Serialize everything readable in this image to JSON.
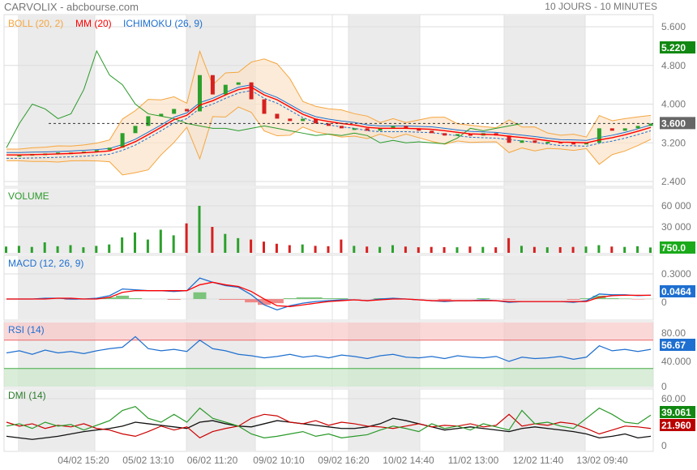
{
  "header": {
    "title": "CARVOLIX - abcbourse.com",
    "period": "10 JOURS - 10 MINUTES"
  },
  "legend": {
    "boll": "BOLL (20, 2)",
    "mm": "MM (20)",
    "ichimoku": "ICHIMOKU (26, 9)",
    "volume": "VOLUME",
    "macd": "MACD (12, 26, 9)",
    "rsi": "RSI (14)",
    "dmi": "DMI (14)"
  },
  "colors": {
    "boll": "#f5a640",
    "mm": "#ff0000",
    "ichimoku": "#1e6fd0",
    "up": "#2ca02c",
    "down": "#d62020",
    "rsi": "#1e6fd0",
    "dmi_plus": "#2a9a2a",
    "dmi_minus": "#cc0000",
    "adx": "#111111"
  },
  "chart_data": {
    "type": "line",
    "x_labels": [
      "04/02 15:20",
      "05/02 13:10",
      "06/02 11:20",
      "09/02 10:10",
      "09/02 16:20",
      "10/02 14:40",
      "11/02 13:00",
      "12/02 11:40",
      "13/02 09:40"
    ],
    "price": {
      "ticks": [
        "5.600",
        "4.800",
        "4.000",
        "3.200",
        "2.400"
      ],
      "ylim": [
        2.4,
        5.6
      ],
      "close": [
        2.95,
        2.95,
        2.97,
        2.98,
        3.0,
        3.0,
        3.02,
        3.05,
        3.1,
        3.4,
        3.55,
        3.75,
        3.8,
        3.9,
        3.85,
        4.6,
        4.2,
        4.4,
        4.45,
        4.1,
        3.8,
        3.7,
        3.65,
        3.7,
        3.6,
        3.55,
        3.5,
        3.5,
        3.45,
        3.5,
        3.55,
        3.5,
        3.45,
        3.4,
        3.35,
        3.38,
        3.35,
        3.4,
        3.35,
        3.2,
        3.25,
        3.2,
        3.22,
        3.2,
        3.18,
        3.2,
        3.5,
        3.45,
        3.5,
        3.55,
        3.6
      ],
      "chikou": [
        3.1,
        3.6,
        4.0,
        3.9,
        3.7,
        3.8,
        4.3,
        5.1,
        4.6,
        4.4,
        4.0,
        3.8,
        3.75,
        3.7,
        3.6,
        3.55,
        3.5,
        3.5,
        3.45,
        3.5,
        3.55,
        3.5,
        3.45,
        3.4,
        3.35,
        3.38,
        3.35,
        3.4,
        3.35,
        3.2,
        3.25,
        3.2,
        3.22,
        3.2,
        3.18,
        3.3,
        3.5,
        3.45,
        3.5,
        3.55,
        3.6
      ],
      "last_close": "3.600",
      "high_marker": "5.220"
    },
    "volume": {
      "ticks": [
        "60 000",
        "30 000"
      ],
      "ylim": [
        0,
        60000
      ],
      "last": "750.0",
      "values": [
        2000,
        3000,
        1500,
        8000,
        2500,
        4000,
        1000,
        3000,
        5000,
        15000,
        22000,
        12000,
        26000,
        18000,
        35000,
        60000,
        30000,
        20000,
        14000,
        12000,
        9000,
        6000,
        4000,
        5000,
        3000,
        2500,
        12000,
        3000,
        2000,
        1500,
        4000,
        2000,
        1000,
        1500,
        1200,
        1000,
        2000,
        1500,
        1000,
        14000,
        3000,
        1500,
        1000,
        1200,
        1500,
        2000,
        4000,
        2000,
        1500,
        2500,
        750
      ]
    },
    "macd": {
      "ticks": [
        "0.3000",
        "0"
      ],
      "ylim": [
        -0.2,
        0.35
      ],
      "last": "0.0464",
      "macd": [
        0,
        0,
        0,
        0.01,
        0.01,
        0,
        0,
        0.01,
        0.04,
        0.12,
        0.11,
        0.1,
        0.1,
        0.09,
        0.1,
        0.25,
        0.2,
        0.16,
        0.14,
        0.05,
        -0.07,
        -0.13,
        -0.08,
        -0.05,
        -0.03,
        -0.02,
        -0.01,
        -0.01,
        -0.02,
        0,
        0.01,
        0,
        -0.01,
        -0.02,
        -0.03,
        -0.02,
        -0.02,
        -0.01,
        -0.02,
        -0.04,
        -0.03,
        -0.03,
        -0.03,
        -0.03,
        -0.04,
        -0.02,
        0.06,
        0.05,
        0.05,
        0.04,
        0.046
      ],
      "signal": [
        0,
        0,
        0,
        0,
        0.01,
        0.01,
        0,
        0,
        0.02,
        0.08,
        0.1,
        0.1,
        0.1,
        0.1,
        0.1,
        0.17,
        0.2,
        0.17,
        0.15,
        0.09,
        0.0,
        -0.08,
        -0.09,
        -0.07,
        -0.05,
        -0.03,
        -0.02,
        -0.01,
        -0.02,
        -0.01,
        0,
        0,
        -0.01,
        -0.02,
        -0.02,
        -0.02,
        -0.02,
        -0.02,
        -0.02,
        -0.03,
        -0.03,
        -0.03,
        -0.03,
        -0.03,
        -0.03,
        -0.03,
        0.02,
        0.04,
        0.045,
        0.045,
        0.045
      ]
    },
    "rsi": {
      "ticks": [
        "80.00",
        "40.000",
        "0"
      ],
      "ylim": [
        0,
        100
      ],
      "last": "56.67",
      "values": [
        52,
        55,
        50,
        56,
        52,
        54,
        51,
        55,
        58,
        60,
        75,
        58,
        55,
        57,
        54,
        70,
        58,
        55,
        50,
        48,
        45,
        47,
        50,
        46,
        48,
        45,
        49,
        47,
        44,
        48,
        50,
        46,
        45,
        47,
        44,
        48,
        46,
        45,
        47,
        40,
        46,
        44,
        45,
        47,
        43,
        46,
        62,
        55,
        57,
        54,
        57
      ]
    },
    "dmi": {
      "ticks": [
        "60.00",
        "0"
      ],
      "ylim": [
        0,
        65
      ],
      "plus_last": "39.061",
      "minus_last": "21.960",
      "plus": [
        25,
        28,
        22,
        30,
        25,
        27,
        20,
        26,
        32,
        45,
        50,
        35,
        30,
        40,
        30,
        48,
        35,
        30,
        25,
        15,
        10,
        12,
        15,
        18,
        12,
        15,
        10,
        12,
        14,
        20,
        25,
        22,
        18,
        28,
        22,
        25,
        20,
        28,
        24,
        20,
        45,
        28,
        30,
        25,
        22,
        35,
        48,
        40,
        30,
        28,
        39
      ],
      "minus": [
        30,
        25,
        28,
        22,
        26,
        24,
        28,
        22,
        20,
        15,
        12,
        18,
        25,
        20,
        24,
        10,
        18,
        22,
        25,
        35,
        40,
        38,
        30,
        28,
        32,
        26,
        30,
        28,
        25,
        24,
        22,
        25,
        28,
        24,
        26,
        25,
        28,
        24,
        26,
        40,
        25,
        28,
        26,
        30,
        28,
        22,
        15,
        20,
        25,
        24,
        22
      ],
      "adx": [
        12,
        10,
        8,
        10,
        12,
        15,
        18,
        20,
        22,
        25,
        30,
        28,
        26,
        24,
        22,
        30,
        32,
        28,
        25,
        24,
        28,
        32,
        30,
        28,
        26,
        24,
        22,
        22,
        24,
        28,
        35,
        32,
        28,
        24,
        20,
        22,
        24,
        22,
        20,
        18,
        22,
        24,
        22,
        20,
        18,
        15,
        10,
        12,
        15,
        10,
        12
      ]
    }
  }
}
